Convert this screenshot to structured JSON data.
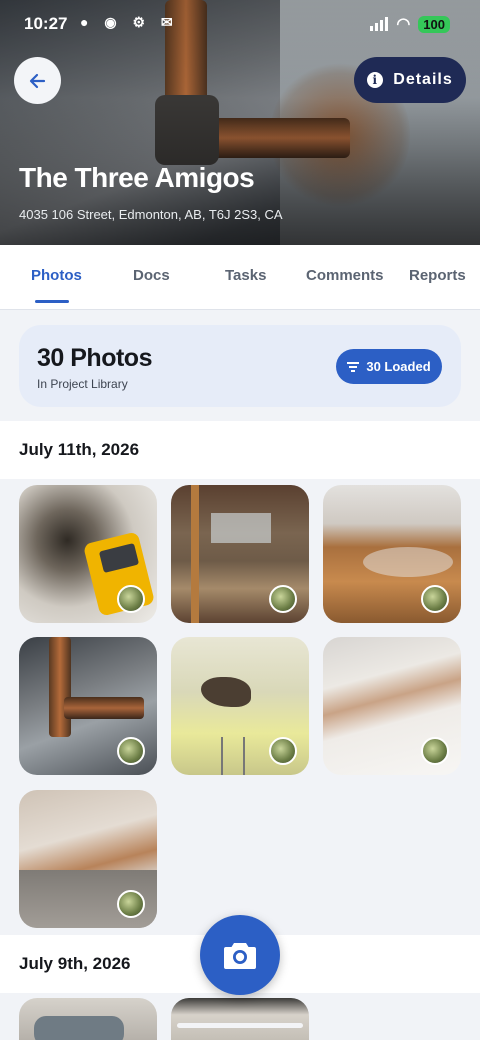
{
  "status_bar": {
    "time": "10:27",
    "battery": "100"
  },
  "header": {
    "details_label": "Details",
    "project_title": "The Three Amigos",
    "address": "4035 106 Street, Edmonton, AB, T6J 2S3, CA"
  },
  "tabs": [
    {
      "label": "Photos",
      "active": true
    },
    {
      "label": "Docs"
    },
    {
      "label": "Tasks"
    },
    {
      "label": "Comments"
    },
    {
      "label": "Reports"
    }
  ],
  "summary": {
    "count_label": "30 Photos",
    "subtitle": "In Project Library",
    "loaded_label": "30 Loaded"
  },
  "sections": [
    {
      "date": "July 11th, 2026",
      "photo_count": 7
    },
    {
      "date": "July 9th, 2026"
    }
  ],
  "colors": {
    "accent": "#2c5fc5",
    "details_bg": "#1f2a55",
    "summary_bg": "#e6ecf8"
  }
}
